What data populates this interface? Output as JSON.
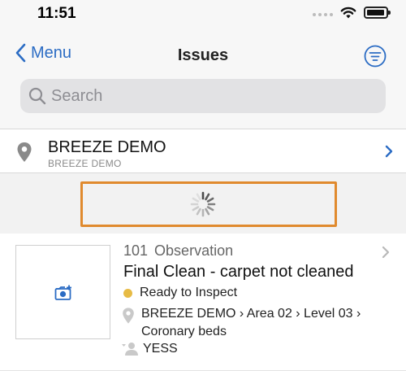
{
  "status_bar": {
    "time": "11:51",
    "icons": [
      "cellular-signal-icon",
      "wifi-icon",
      "battery-icon"
    ]
  },
  "nav": {
    "back_label": "Menu",
    "title": "Issues",
    "filter_icon": "filter-icon"
  },
  "search": {
    "placeholder": "Search",
    "value": ""
  },
  "location": {
    "name": "BREEZE DEMO",
    "subtitle": "BREEZE DEMO"
  },
  "loading": {
    "indicator": "activity-spinner-icon",
    "highlight_color": "#e08a2e"
  },
  "issues": [
    {
      "number": "101",
      "type": "Observation",
      "title": "Final Clean - carpet not cleaned",
      "status": "Ready to Inspect",
      "status_color": "#e7bb45",
      "location_path": "BREEZE DEMO › Area 02 › Level 03 › Coronary beds",
      "assignee": "YESS",
      "thumbnail_icon": "add-photo-icon"
    }
  ],
  "colors": {
    "accent": "#2b6cc4",
    "header_background": "#f7f7f7",
    "search_background": "#e2e2e4"
  }
}
